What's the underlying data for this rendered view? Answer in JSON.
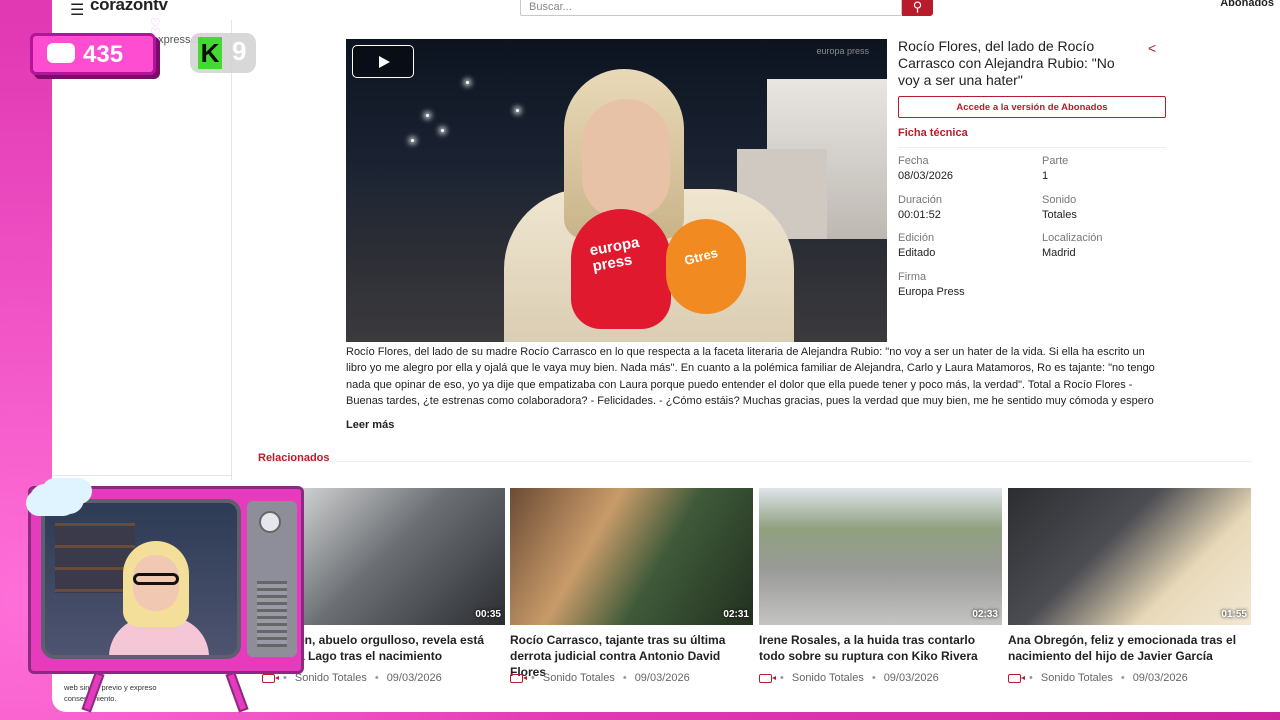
{
  "header": {
    "logo": "corazontv",
    "search_placeholder": "Buscar...",
    "subscribers_link": "Abonados"
  },
  "sidebar": {
    "domain_text": "express.tv"
  },
  "video": {
    "watermark": "europa press"
  },
  "info": {
    "title": "Rocío Flores, del lado de Rocío Carrasco con Alejandra Rubio: \"No voy a ser una hater\"",
    "subscribe_button": "Accede a la versión de Abonados",
    "ficha_label": "Ficha técnica",
    "fields": [
      {
        "label": "Fecha",
        "value": "08/03/2026"
      },
      {
        "label": "Parte",
        "value": "1"
      },
      {
        "label": "Duración",
        "value": "00:01:52"
      },
      {
        "label": "Sonido",
        "value": "Totales"
      },
      {
        "label": "Edición",
        "value": "Editado"
      },
      {
        "label": "Localización",
        "value": "Madrid"
      },
      {
        "label": "Firma",
        "value": "Europa Press"
      }
    ]
  },
  "description": "Rocío Flores, del lado de su madre Rocío Carrasco en lo que respecta a la faceta literaria de Alejandra Rubio: \"no voy a ser un hater de la vida. Si ella ha escrito un libro yo me alegro por ella y ojalá que le vaya muy bien. Nada más\". En cuanto a la polémica familiar de Alejandra, Carlo y Laura Matamoros, Ro es tajante: \"no tengo nada que opinar de eso, yo ya dije que empatizaba con Laura porque puedo entender el dolor que ella puede tener y poco más, la verdad\". Total a Rocío Flores - Buenas tardes, ¿te estrenas como colaboradora? - Felicidades. - ¿Cómo estáis? Muchas gracias, pues la verdad que muy bien, me he sentido muy cómoda y espero",
  "read_more": "Leer más",
  "related": {
    "title": "Relacionados",
    "items": [
      {
        "title": "Obregón, abuelo orgulloso, revela está Paloma Lago tras el nacimiento",
        "duration": "00:35",
        "sound": "Sonido Totales",
        "date": "09/03/2026",
        "thumb_color": "#6b6f73"
      },
      {
        "title": "Rocío Carrasco, tajante tras su última derrota judicial contra Antonio David Flores",
        "duration": "02:31",
        "sound": "Sonido Totales",
        "date": "09/03/2026",
        "thumb_color": "#3f5a3a"
      },
      {
        "title": "Irene Rosales, a la huida tras contarlo todo sobre su ruptura con Kiko Rivera",
        "duration": "02:33",
        "sound": "Sonido Totales",
        "date": "09/03/2026",
        "thumb_color": "#9a9a98"
      },
      {
        "title": "Ana Obregón, feliz y emocionada tras el nacimiento del hijo de Javier García",
        "duration": "01:55",
        "sound": "Sonido Totales",
        "date": "09/03/2026",
        "thumb_color": "#4b4d52"
      }
    ]
  },
  "overlay": {
    "chat_count": "435",
    "k_label": "K",
    "k_count": "9",
    "footer_text": "web sin su previo y expreso consentimiento."
  }
}
